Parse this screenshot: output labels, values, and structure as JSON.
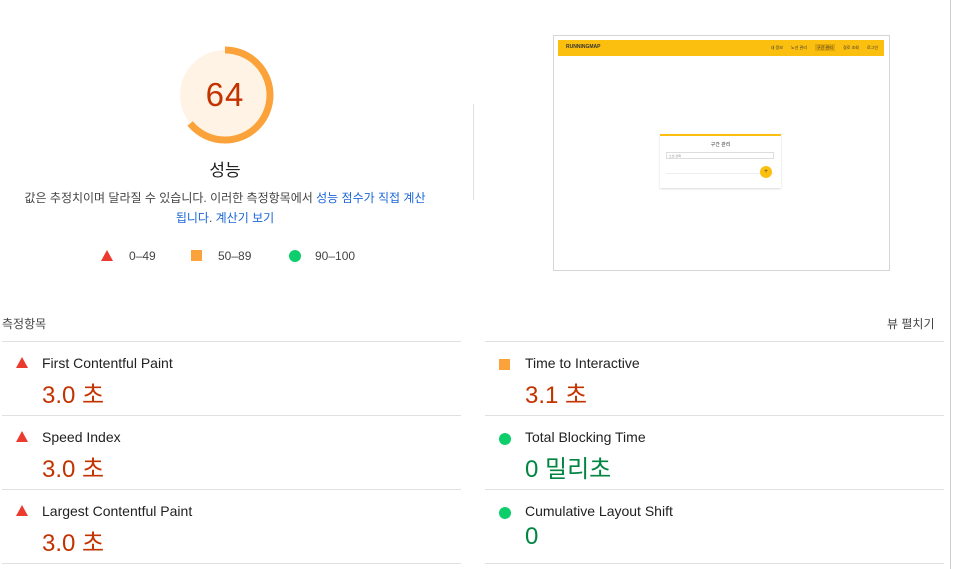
{
  "gauge": {
    "score": "64",
    "score_fraction": 0.64,
    "title": "성능",
    "description_plain": "값은 추정치이며 달라질 수 있습니다. 이러한 측정항목에서 ",
    "description_link1": "성능 점수가 직접 계산됩니다",
    "description_mid": ". ",
    "description_link2": "계산기 보기",
    "color": "#fba33a",
    "text_color": "#c33300"
  },
  "legend": [
    {
      "range": "0–49",
      "icon": "red-triangle-icon"
    },
    {
      "range": "50–89",
      "icon": "orange-square-icon"
    },
    {
      "range": "90–100",
      "icon": "green-circle-icon"
    }
  ],
  "preview": {
    "logo": "RUNNINGMAP",
    "nav": [
      "내 정보",
      "노선 관리",
      "구간 관리",
      "경로 조회",
      "로그인"
    ],
    "active_nav": "구간 관리",
    "card_title": "구간 관리",
    "select_placeholder": "노선 선택",
    "fab_symbol": "+"
  },
  "metrics_header": "측정항목",
  "view_toggle": "뷰 펼치기",
  "metrics": {
    "left": [
      {
        "name": "First Contentful Paint",
        "value": "3.0 초",
        "status": "fail"
      },
      {
        "name": "Speed Index",
        "value": "3.0 초",
        "status": "fail"
      },
      {
        "name": "Largest Contentful Paint",
        "value": "3.0 초",
        "status": "fail"
      }
    ],
    "right": [
      {
        "name": "Time to Interactive",
        "value": "3.1 초",
        "status": "average"
      },
      {
        "name": "Total Blocking Time",
        "value": "0 밀리초",
        "status": "pass"
      },
      {
        "name": "Cumulative Layout Shift",
        "value": "0",
        "status": "pass"
      }
    ]
  },
  "colors": {
    "fail": "#eb3a2e",
    "average": "#fba33a",
    "pass": "#0cce6b",
    "link": "#1a66d8"
  }
}
